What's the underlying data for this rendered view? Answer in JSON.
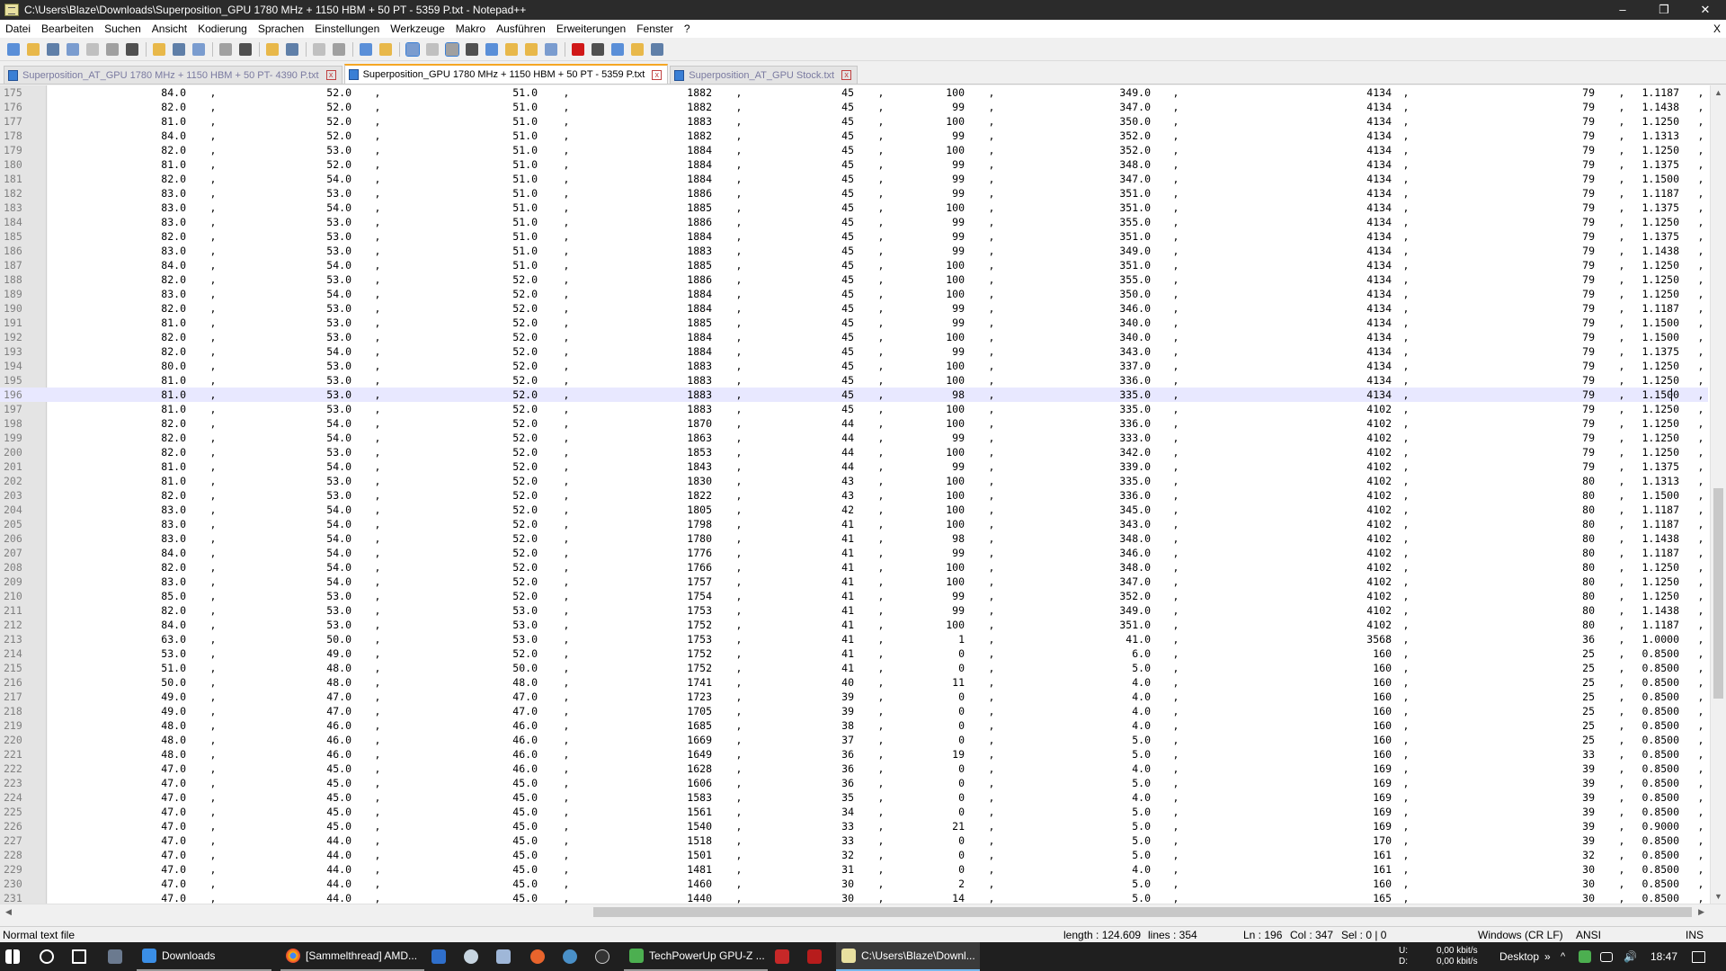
{
  "window": {
    "title": "C:\\Users\\Blaze\\Downloads\\Superposition_GPU 1780 MHz + 1150 HBM + 50 PT - 5359 P.txt - Notepad++",
    "minimize": "–",
    "maximize": "❐",
    "close": "✕"
  },
  "menu": {
    "items": [
      "Datei",
      "Bearbeiten",
      "Suchen",
      "Ansicht",
      "Kodierung",
      "Sprachen",
      "Einstellungen",
      "Werkzeuge",
      "Makro",
      "Ausführen",
      "Erweiterungen",
      "Fenster",
      "?"
    ],
    "close_doc": "X"
  },
  "toolbar": {
    "icons": [
      "new-file-icon",
      "open-file-icon",
      "save-icon",
      "save-all-icon",
      "close-icon",
      "close-all-icon",
      "print-icon",
      "|",
      "cut-icon",
      "copy-icon",
      "paste-icon",
      "|",
      "undo-icon",
      "redo-icon",
      "|",
      "find-icon",
      "replace-icon",
      "|",
      "zoom-in-icon",
      "zoom-out-icon",
      "|",
      "sync-vertical-icon",
      "sync-horizontal-icon",
      "|",
      "word-wrap-icon",
      "show-all-chars-icon",
      "indent-guide-icon",
      "user-language-icon",
      "doc-map-icon",
      "function-list-icon",
      "folder-workspace-icon",
      "monitoring-icon",
      "|",
      "record-macro-icon",
      "stop-macro-icon",
      "play-macro-icon",
      "run-macro-multiple-icon",
      "save-macro-icon"
    ],
    "colors": {
      "accent": "#3a7fd5",
      "record": "#d01818",
      "folder": "#e8b84a"
    }
  },
  "tabs": [
    {
      "label": "Superposition_AT_GPU 1780 MHz + 1150 HBM + 50 PT- 4390 P.txt",
      "active": false
    },
    {
      "label": "Superposition_GPU 1780 MHz + 1150 HBM + 50 PT - 5359 P.txt",
      "active": true
    },
    {
      "label": "Superposition_AT_GPU Stock.txt",
      "active": false
    }
  ],
  "editor": {
    "current_line": 196,
    "rows": [
      [
        175,
        "84.0",
        "52.0",
        "51.0",
        "1882",
        "45",
        "100",
        "349.0",
        "4134",
        "79",
        "1.1187"
      ],
      [
        176,
        "82.0",
        "52.0",
        "51.0",
        "1882",
        "45",
        "99",
        "347.0",
        "4134",
        "79",
        "1.1438"
      ],
      [
        177,
        "81.0",
        "52.0",
        "51.0",
        "1883",
        "45",
        "100",
        "350.0",
        "4134",
        "79",
        "1.1250"
      ],
      [
        178,
        "84.0",
        "52.0",
        "51.0",
        "1882",
        "45",
        "99",
        "352.0",
        "4134",
        "79",
        "1.1313"
      ],
      [
        179,
        "82.0",
        "53.0",
        "51.0",
        "1884",
        "45",
        "100",
        "352.0",
        "4134",
        "79",
        "1.1250"
      ],
      [
        180,
        "81.0",
        "52.0",
        "51.0",
        "1884",
        "45",
        "99",
        "348.0",
        "4134",
        "79",
        "1.1375"
      ],
      [
        181,
        "82.0",
        "54.0",
        "51.0",
        "1884",
        "45",
        "99",
        "347.0",
        "4134",
        "79",
        "1.1500"
      ],
      [
        182,
        "83.0",
        "53.0",
        "51.0",
        "1886",
        "45",
        "99",
        "351.0",
        "4134",
        "79",
        "1.1187"
      ],
      [
        183,
        "83.0",
        "54.0",
        "51.0",
        "1885",
        "45",
        "100",
        "351.0",
        "4134",
        "79",
        "1.1375"
      ],
      [
        184,
        "83.0",
        "53.0",
        "51.0",
        "1886",
        "45",
        "99",
        "355.0",
        "4134",
        "79",
        "1.1250"
      ],
      [
        185,
        "82.0",
        "53.0",
        "51.0",
        "1884",
        "45",
        "99",
        "351.0",
        "4134",
        "79",
        "1.1375"
      ],
      [
        186,
        "83.0",
        "53.0",
        "51.0",
        "1883",
        "45",
        "99",
        "349.0",
        "4134",
        "79",
        "1.1438"
      ],
      [
        187,
        "84.0",
        "54.0",
        "51.0",
        "1885",
        "45",
        "100",
        "351.0",
        "4134",
        "79",
        "1.1250"
      ],
      [
        188,
        "82.0",
        "53.0",
        "52.0",
        "1886",
        "45",
        "100",
        "355.0",
        "4134",
        "79",
        "1.1250"
      ],
      [
        189,
        "83.0",
        "54.0",
        "52.0",
        "1884",
        "45",
        "100",
        "350.0",
        "4134",
        "79",
        "1.1250"
      ],
      [
        190,
        "82.0",
        "53.0",
        "52.0",
        "1884",
        "45",
        "99",
        "346.0",
        "4134",
        "79",
        "1.1187"
      ],
      [
        191,
        "81.0",
        "53.0",
        "52.0",
        "1885",
        "45",
        "99",
        "340.0",
        "4134",
        "79",
        "1.1500"
      ],
      [
        192,
        "82.0",
        "53.0",
        "52.0",
        "1884",
        "45",
        "100",
        "340.0",
        "4134",
        "79",
        "1.1500"
      ],
      [
        193,
        "82.0",
        "54.0",
        "52.0",
        "1884",
        "45",
        "99",
        "343.0",
        "4134",
        "79",
        "1.1375"
      ],
      [
        194,
        "80.0",
        "53.0",
        "52.0",
        "1883",
        "45",
        "100",
        "337.0",
        "4134",
        "79",
        "1.1250"
      ],
      [
        195,
        "81.0",
        "53.0",
        "52.0",
        "1883",
        "45",
        "100",
        "336.0",
        "4134",
        "79",
        "1.1250"
      ],
      [
        196,
        "81.0",
        "53.0",
        "52.0",
        "1883",
        "45",
        "98",
        "335.0",
        "4134",
        "79",
        "1.1500"
      ],
      [
        197,
        "81.0",
        "53.0",
        "52.0",
        "1883",
        "45",
        "100",
        "335.0",
        "4102",
        "79",
        "1.1250"
      ],
      [
        198,
        "82.0",
        "54.0",
        "52.0",
        "1870",
        "44",
        "100",
        "336.0",
        "4102",
        "79",
        "1.1250"
      ],
      [
        199,
        "82.0",
        "54.0",
        "52.0",
        "1863",
        "44",
        "99",
        "333.0",
        "4102",
        "79",
        "1.1250"
      ],
      [
        200,
        "82.0",
        "53.0",
        "52.0",
        "1853",
        "44",
        "100",
        "342.0",
        "4102",
        "79",
        "1.1250"
      ],
      [
        201,
        "81.0",
        "54.0",
        "52.0",
        "1843",
        "44",
        "99",
        "339.0",
        "4102",
        "79",
        "1.1375"
      ],
      [
        202,
        "81.0",
        "53.0",
        "52.0",
        "1830",
        "43",
        "100",
        "335.0",
        "4102",
        "80",
        "1.1313"
      ],
      [
        203,
        "82.0",
        "53.0",
        "52.0",
        "1822",
        "43",
        "100",
        "336.0",
        "4102",
        "80",
        "1.1500"
      ],
      [
        204,
        "83.0",
        "54.0",
        "52.0",
        "1805",
        "42",
        "100",
        "345.0",
        "4102",
        "80",
        "1.1187"
      ],
      [
        205,
        "83.0",
        "54.0",
        "52.0",
        "1798",
        "41",
        "100",
        "343.0",
        "4102",
        "80",
        "1.1187"
      ],
      [
        206,
        "83.0",
        "54.0",
        "52.0",
        "1780",
        "41",
        "98",
        "348.0",
        "4102",
        "80",
        "1.1438"
      ],
      [
        207,
        "84.0",
        "54.0",
        "52.0",
        "1776",
        "41",
        "99",
        "346.0",
        "4102",
        "80",
        "1.1187"
      ],
      [
        208,
        "82.0",
        "54.0",
        "52.0",
        "1766",
        "41",
        "100",
        "348.0",
        "4102",
        "80",
        "1.1250"
      ],
      [
        209,
        "83.0",
        "54.0",
        "52.0",
        "1757",
        "41",
        "100",
        "347.0",
        "4102",
        "80",
        "1.1250"
      ],
      [
        210,
        "85.0",
        "53.0",
        "52.0",
        "1754",
        "41",
        "99",
        "352.0",
        "4102",
        "80",
        "1.1250"
      ],
      [
        211,
        "82.0",
        "53.0",
        "53.0",
        "1753",
        "41",
        "99",
        "349.0",
        "4102",
        "80",
        "1.1438"
      ],
      [
        212,
        "84.0",
        "53.0",
        "53.0",
        "1752",
        "41",
        "100",
        "351.0",
        "4102",
        "80",
        "1.1187"
      ],
      [
        213,
        "63.0",
        "50.0",
        "53.0",
        "1753",
        "41",
        "1",
        "41.0",
        "3568",
        "36",
        "1.0000"
      ],
      [
        214,
        "53.0",
        "49.0",
        "52.0",
        "1752",
        "41",
        "0",
        "6.0",
        "160",
        "25",
        "0.8500"
      ],
      [
        215,
        "51.0",
        "48.0",
        "50.0",
        "1752",
        "41",
        "0",
        "5.0",
        "160",
        "25",
        "0.8500"
      ],
      [
        216,
        "50.0",
        "48.0",
        "48.0",
        "1741",
        "40",
        "11",
        "4.0",
        "160",
        "25",
        "0.8500"
      ],
      [
        217,
        "49.0",
        "47.0",
        "47.0",
        "1723",
        "39",
        "0",
        "4.0",
        "160",
        "25",
        "0.8500"
      ],
      [
        218,
        "49.0",
        "47.0",
        "47.0",
        "1705",
        "39",
        "0",
        "4.0",
        "160",
        "25",
        "0.8500"
      ],
      [
        219,
        "48.0",
        "46.0",
        "46.0",
        "1685",
        "38",
        "0",
        "4.0",
        "160",
        "25",
        "0.8500"
      ],
      [
        220,
        "48.0",
        "46.0",
        "46.0",
        "1669",
        "37",
        "0",
        "5.0",
        "160",
        "25",
        "0.8500"
      ],
      [
        221,
        "48.0",
        "46.0",
        "46.0",
        "1649",
        "36",
        "19",
        "5.0",
        "160",
        "33",
        "0.8500"
      ],
      [
        222,
        "47.0",
        "45.0",
        "46.0",
        "1628",
        "36",
        "0",
        "4.0",
        "169",
        "39",
        "0.8500"
      ],
      [
        223,
        "47.0",
        "45.0",
        "45.0",
        "1606",
        "36",
        "0",
        "5.0",
        "169",
        "39",
        "0.8500"
      ],
      [
        224,
        "47.0",
        "45.0",
        "45.0",
        "1583",
        "35",
        "0",
        "4.0",
        "169",
        "39",
        "0.8500"
      ],
      [
        225,
        "47.0",
        "45.0",
        "45.0",
        "1561",
        "34",
        "0",
        "5.0",
        "169",
        "39",
        "0.8500"
      ],
      [
        226,
        "47.0",
        "45.0",
        "45.0",
        "1540",
        "33",
        "21",
        "5.0",
        "169",
        "39",
        "0.9000"
      ],
      [
        227,
        "47.0",
        "44.0",
        "45.0",
        "1518",
        "33",
        "0",
        "5.0",
        "170",
        "39",
        "0.8500"
      ],
      [
        228,
        "47.0",
        "44.0",
        "45.0",
        "1501",
        "32",
        "0",
        "5.0",
        "161",
        "32",
        "0.8500"
      ],
      [
        229,
        "47.0",
        "44.0",
        "45.0",
        "1481",
        "31",
        "0",
        "4.0",
        "161",
        "30",
        "0.8500"
      ],
      [
        230,
        "47.0",
        "44.0",
        "45.0",
        "1460",
        "30",
        "2",
        "5.0",
        "160",
        "30",
        "0.8500"
      ],
      [
        231,
        "47.0",
        "44.0",
        "45.0",
        "1440",
        "30",
        "14",
        "5.0",
        "165",
        "30",
        "0.8500"
      ]
    ]
  },
  "status": {
    "file_type": "Normal text file",
    "length": "length : 124.609",
    "lines": "lines : 354",
    "ln": "Ln : 196",
    "col": "Col : 347",
    "sel": "Sel : 0 | 0",
    "eol": "Windows (CR LF)",
    "encoding": "ANSI",
    "mode": "INS"
  },
  "taskbar": {
    "items": [
      {
        "label": "",
        "icon": "windows-start-icon"
      },
      {
        "label": "",
        "icon": "cortana-search-icon"
      },
      {
        "label": "",
        "icon": "task-view-icon"
      },
      {
        "label": "",
        "icon": "pinned-app-icon"
      },
      {
        "label": "Downloads",
        "icon": "downloads-icon"
      },
      {
        "label": "[Sammelthread] AMD...",
        "icon": "chrome-icon"
      },
      {
        "label": "",
        "icon": "app-blue-icon"
      },
      {
        "label": "",
        "icon": "steam-icon"
      },
      {
        "label": "",
        "icon": "app-white-icon"
      },
      {
        "label": "",
        "icon": "app-orange-icon"
      },
      {
        "label": "",
        "icon": "app-moon-icon"
      },
      {
        "label": "",
        "icon": "app-play-icon"
      },
      {
        "label": "TechPowerUp GPU-Z ...",
        "icon": "gpu-z-icon"
      },
      {
        "label": "",
        "icon": "app-red-icon"
      },
      {
        "label": "",
        "icon": "app-red2-icon"
      },
      {
        "label": "C:\\Users\\Blaze\\Downl...",
        "icon": "notepadpp-icon"
      }
    ],
    "net_up_label": "U:",
    "net_down_label": "D:",
    "net_up": "0,00 kbit/s",
    "net_down": "0,00 kbit/s",
    "desktop": "Desktop",
    "more": "»",
    "time": "18:47"
  }
}
